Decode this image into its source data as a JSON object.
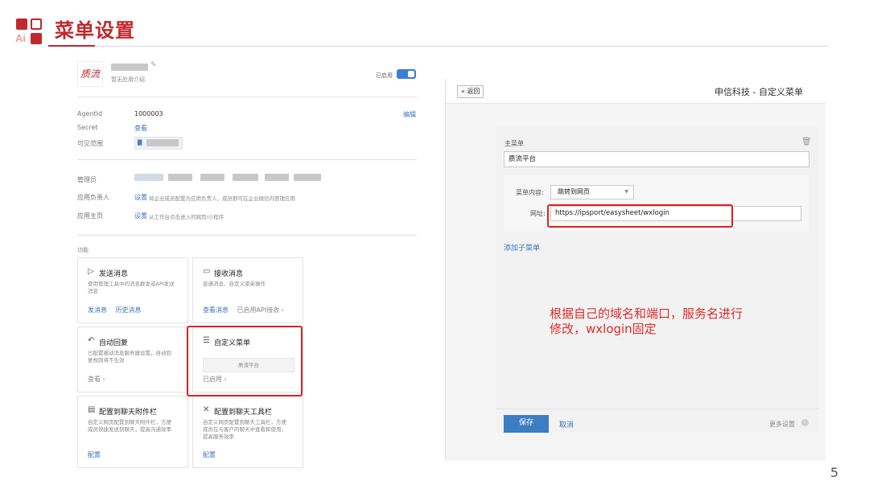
{
  "slide": {
    "title": "菜单设置",
    "logo_text": "Ai",
    "page_number": "5"
  },
  "left": {
    "app_logo_text": "质流",
    "app_desc": "暂无应用介绍",
    "status_label": "已启用",
    "agentid_label": "AgentId",
    "agentid_value": "1000003",
    "secret_label": "Secret",
    "secret_link": "查看",
    "scope_label": "可见范围",
    "edit_link": "编辑",
    "admin_label": "管理员",
    "owner_label": "应用负责人",
    "owner_link": "设置",
    "owner_desc": "将企业成员配置为应用负责人，成员即可在企业微信内管理应用",
    "home_label": "应用主页",
    "home_link": "设置",
    "home_desc": "从工作台点击进入的网页/小程序",
    "features_label": "功能",
    "cards": {
      "send": {
        "title": "发送消息",
        "desc": "使用管理工具中的消息群发或API发送消息",
        "link1": "发消息",
        "link2": "历史消息"
      },
      "receive": {
        "title": "接收消息",
        "desc": "普通消息、自定义菜单操作",
        "link1": "查看消息",
        "link2": "已启用API接收 ›"
      },
      "auto": {
        "title": "自动回复",
        "desc": "已配置被动消息服务器设置，自动回复规则将不生效",
        "link1": "查看 ›"
      },
      "menu": {
        "title": "自定义菜单",
        "preview": "质流平台",
        "link1": "已启用 ›"
      },
      "sidebar": {
        "title": "配置到聊天附件栏",
        "desc": "自定义网页配置到聊天附件栏，方便成员快捷发送到聊天，提高沟通效率",
        "link1": "配置"
      },
      "toolbar": {
        "title": "配置到聊天工具栏",
        "desc": "自定义网页配置到聊天工具栏，方便成员在与客户的聊天中查看和使用，提高服务效率",
        "link1": "配置"
      }
    }
  },
  "right": {
    "back_label": "« 返回",
    "header_title": "申信科技 - 自定义菜单",
    "main_menu_label": "主菜单",
    "main_menu_value": "质流平台",
    "content_label": "菜单内容:",
    "content_select": "跳转到网页",
    "url_label": "网址:",
    "url_value": "https://ipsport/easysheet/wxlogin",
    "add_submenu": "添加子菜单",
    "save_label": "保存",
    "cancel_label": "取消",
    "more_label": "更多设置"
  },
  "annotation": {
    "line1": "根据自己的域名和端口，服务名进行",
    "line2": "修改，wxlogin固定"
  },
  "colors": {
    "brand_red": "#c0282d",
    "accent_blue": "#3c7dc4",
    "highlight_red": "#e02020"
  }
}
